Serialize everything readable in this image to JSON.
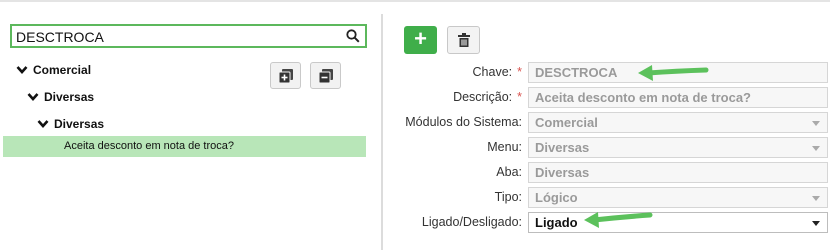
{
  "search": {
    "value": "DESCTROCA"
  },
  "tree": {
    "nodes": [
      {
        "label": "Comercial"
      },
      {
        "label": "Diversas"
      },
      {
        "label": "Diversas"
      }
    ],
    "selected_leaf": "Aceita desconto em nota de troca?"
  },
  "toolbar": {
    "add_label": "+"
  },
  "form": {
    "chave": {
      "label": "Chave:",
      "value": "DESCTROCA",
      "required": "*"
    },
    "descricao": {
      "label": "Descrição:",
      "value": "Aceita desconto em nota de troca?",
      "required": "*"
    },
    "modulos": {
      "label": "Módulos do Sistema:",
      "value": "Comercial"
    },
    "menu": {
      "label": "Menu:",
      "value": "Diversas"
    },
    "aba": {
      "label": "Aba:",
      "value": "Diversas"
    },
    "tipo": {
      "label": "Tipo:",
      "value": "Lógico"
    },
    "ligado": {
      "label": "Ligado/Desligado:",
      "value": "Ligado"
    }
  },
  "colors": {
    "accent": "#3fae4a",
    "selected_row": "#b8e6b8",
    "annotation_arrow": "#5cc15c",
    "required": "#d9534f"
  }
}
